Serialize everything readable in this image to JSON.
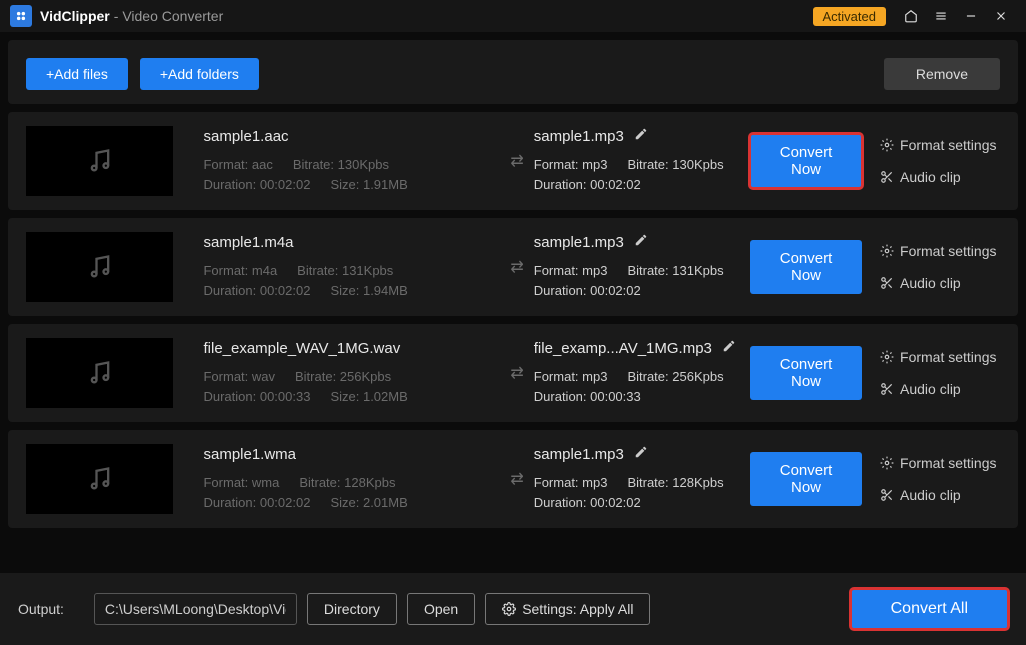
{
  "titlebar": {
    "app_name": "VidClipper",
    "app_sub": " - Video Converter",
    "badge": "Activated"
  },
  "toolbar": {
    "add_files": "+Add files",
    "add_folders": "+Add folders",
    "remove": "Remove"
  },
  "labels": {
    "format_settings": "Format settings",
    "audio_clip": "Audio clip",
    "convert_now": "Convert Now"
  },
  "items": [
    {
      "src_name": "sample1.aac",
      "src_format": "Format: aac",
      "src_bitrate": "Bitrate: 130Kpbs",
      "src_duration": "Duration: 00:02:02",
      "src_size": "Size: 1.91MB",
      "dst_name": "sample1.mp3",
      "dst_format": "Format: mp3",
      "dst_bitrate": "Bitrate: 130Kpbs",
      "dst_duration": "Duration: 00:02:02",
      "highlight": true
    },
    {
      "src_name": "sample1.m4a",
      "src_format": "Format: m4a",
      "src_bitrate": "Bitrate: 131Kpbs",
      "src_duration": "Duration: 00:02:02",
      "src_size": "Size: 1.94MB",
      "dst_name": "sample1.mp3",
      "dst_format": "Format: mp3",
      "dst_bitrate": "Bitrate: 131Kpbs",
      "dst_duration": "Duration: 00:02:02",
      "highlight": false
    },
    {
      "src_name": "file_example_WAV_1MG.wav",
      "src_format": "Format: wav",
      "src_bitrate": "Bitrate: 256Kpbs",
      "src_duration": "Duration: 00:00:33",
      "src_size": "Size: 1.02MB",
      "dst_name": "file_examp...AV_1MG.mp3",
      "dst_format": "Format: mp3",
      "dst_bitrate": "Bitrate: 256Kpbs",
      "dst_duration": "Duration: 00:00:33",
      "highlight": false
    },
    {
      "src_name": "sample1.wma",
      "src_format": "Format: wma",
      "src_bitrate": "Bitrate: 128Kpbs",
      "src_duration": "Duration: 00:02:02",
      "src_size": "Size: 2.01MB",
      "dst_name": "sample1.mp3",
      "dst_format": "Format: mp3",
      "dst_bitrate": "Bitrate: 128Kpbs",
      "dst_duration": "Duration: 00:02:02",
      "highlight": false
    }
  ],
  "footer": {
    "output_label": "Output:",
    "output_path": "C:\\Users\\MLoong\\Desktop\\VidClipper",
    "directory": "Directory",
    "open": "Open",
    "settings": "Settings: Apply All",
    "convert_all": "Convert All"
  }
}
